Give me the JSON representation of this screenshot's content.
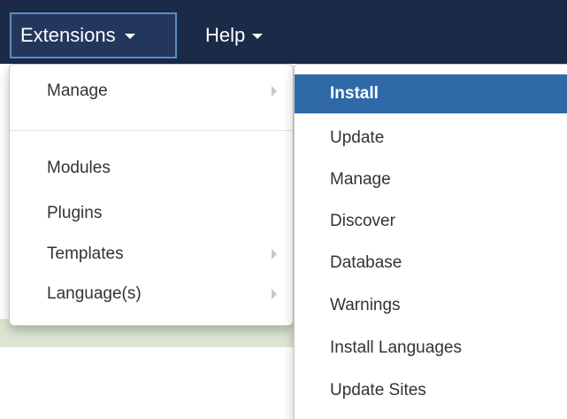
{
  "navbar": {
    "extensions_label": "Extensions",
    "help_label": "Help"
  },
  "extensions_menu": {
    "items": [
      {
        "label": "Manage",
        "has_submenu": true
      },
      {
        "label": "Modules",
        "has_submenu": false
      },
      {
        "label": "Plugins",
        "has_submenu": false
      },
      {
        "label": "Templates",
        "has_submenu": true
      },
      {
        "label": "Language(s)",
        "has_submenu": true
      }
    ]
  },
  "manage_submenu": {
    "items": [
      {
        "label": "Install",
        "active": true
      },
      {
        "label": "Update",
        "active": false
      },
      {
        "label": "Manage",
        "active": false
      },
      {
        "label": "Discover",
        "active": false
      },
      {
        "label": "Database",
        "active": false
      },
      {
        "label": "Warnings",
        "active": false
      },
      {
        "label": "Install Languages",
        "active": false
      },
      {
        "label": "Update Sites",
        "active": false
      }
    ]
  },
  "colors": {
    "navbar_bg": "#1b2a47",
    "active_item_bg": "#2f69a8",
    "text": "#333333"
  }
}
